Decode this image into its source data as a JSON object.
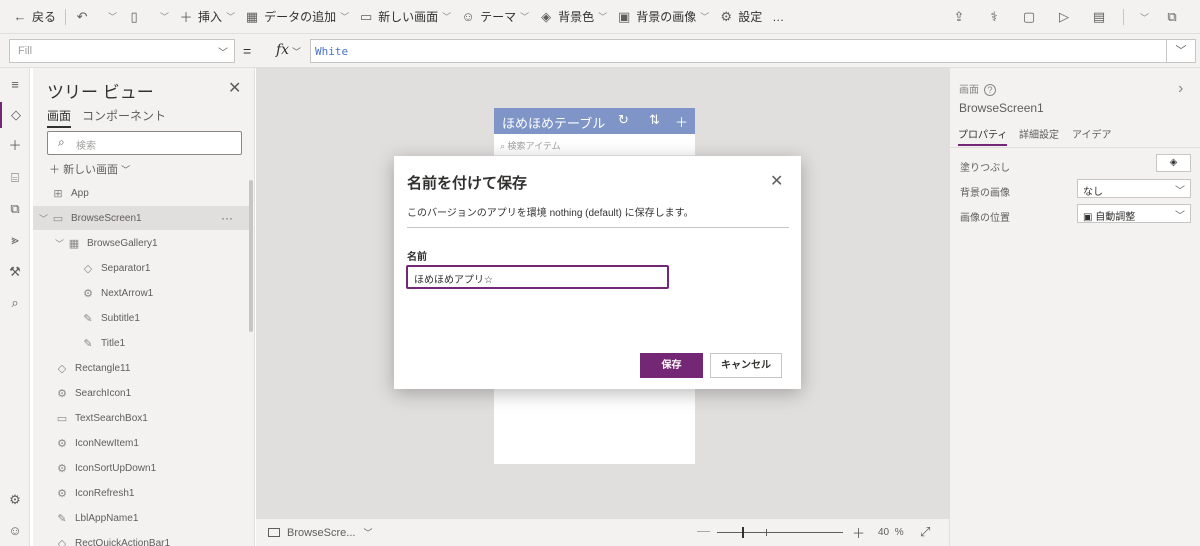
{
  "toolbar": {
    "back": "戻る",
    "insert": "挿入",
    "add_data": "データの追加",
    "new_screen": "新しい画面",
    "theme": "テーマ",
    "background_color": "背景色",
    "background_image": "背景の画像",
    "settings": "設定",
    "more": "…"
  },
  "formula_bar": {
    "property": "Fill",
    "equals": "=",
    "fx": "fx",
    "formula": "White"
  },
  "tree_view": {
    "title": "ツリー ビュー",
    "tabs": [
      "画面",
      "コンポーネント"
    ],
    "search_placeholder": "検索",
    "new_screen": "新しい画面",
    "items": [
      {
        "label": "App",
        "icon": "app-icon",
        "indent": 0
      },
      {
        "label": "BrowseScreen1",
        "icon": "screen-icon",
        "indent": 0,
        "selected": true
      },
      {
        "label": "BrowseGallery1",
        "icon": "gallery-icon",
        "indent": 1
      },
      {
        "label": "Separator1",
        "icon": "shape-icon",
        "indent": 2
      },
      {
        "label": "NextArrow1",
        "icon": "icon-control-icon",
        "indent": 2
      },
      {
        "label": "Subtitle1",
        "icon": "label-icon",
        "indent": 2
      },
      {
        "label": "Title1",
        "icon": "label-icon",
        "indent": 2
      },
      {
        "label": "Rectangle11",
        "icon": "shape-icon",
        "indent": 1
      },
      {
        "label": "SearchIcon1",
        "icon": "icon-control-icon",
        "indent": 1
      },
      {
        "label": "TextSearchBox1",
        "icon": "textbox-icon",
        "indent": 1
      },
      {
        "label": "IconNewItem1",
        "icon": "icon-control-icon",
        "indent": 1
      },
      {
        "label": "IconSortUpDown1",
        "icon": "icon-control-icon",
        "indent": 1
      },
      {
        "label": "IconRefresh1",
        "icon": "icon-control-icon",
        "indent": 1
      },
      {
        "label": "LblAppName1",
        "icon": "label-icon",
        "indent": 1
      },
      {
        "label": "RectQuickActionBar1",
        "icon": "shape-icon",
        "indent": 1
      }
    ]
  },
  "canvas": {
    "app_title": "ほめほめテーブル",
    "search_placeholder": "検索アイテム",
    "header_color": "#7f95c7"
  },
  "status_bar": {
    "screen": "BrowseScre...",
    "zoom": "40",
    "zoom_unit": "%",
    "zoom_level": 0.4
  },
  "properties": {
    "kind": "画面",
    "name": "BrowseScreen1",
    "tabs": [
      "プロパティ",
      "詳細設定",
      "アイデア"
    ],
    "fill_label": "塗りつぶし",
    "bg_image_label": "背景の画像",
    "bg_image_value": "なし",
    "image_pos_label": "画像の位置",
    "image_pos_value": "自動調整"
  },
  "dialog": {
    "title": "名前を付けて保存",
    "description": "このバージョンのアプリを環境 nothing (default) に保存します。",
    "name_label": "名前",
    "name_value": "ほめほめアプリ☆",
    "save": "保存",
    "cancel": "キャンセル"
  },
  "colors": {
    "accent": "#742774",
    "header": "#7f95c7"
  }
}
